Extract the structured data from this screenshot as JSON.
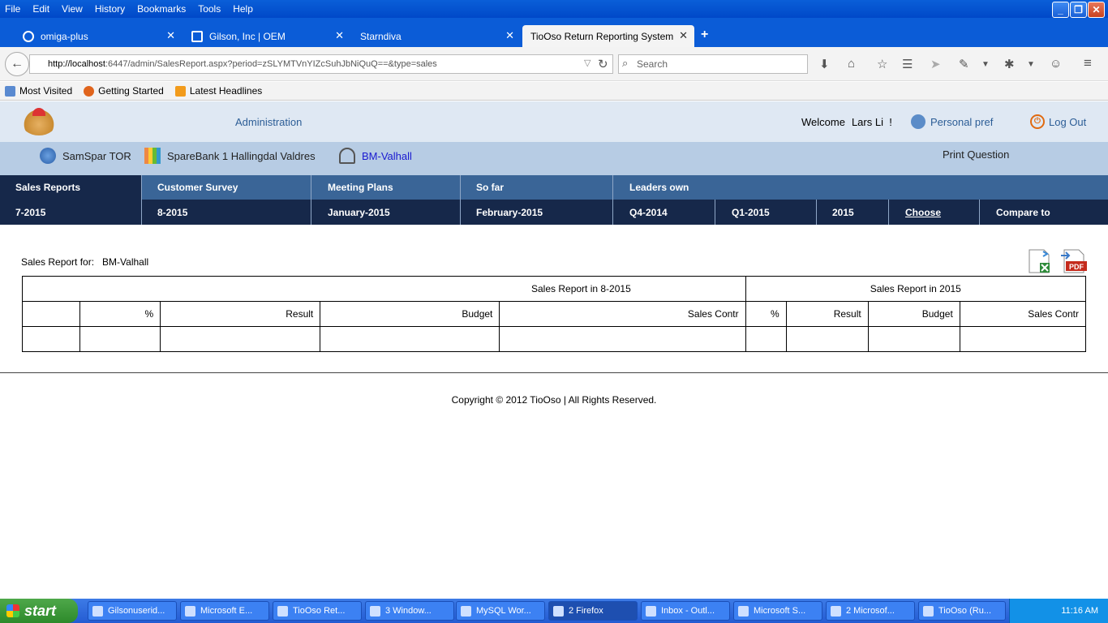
{
  "menu": [
    "File",
    "Edit",
    "View",
    "History",
    "Bookmarks",
    "Tools",
    "Help"
  ],
  "tabs": [
    {
      "label": "omiga-plus"
    },
    {
      "label": "Gilson, Inc | OEM"
    },
    {
      "label": "Starndiva"
    },
    {
      "label": "TioOso Return Reporting System"
    }
  ],
  "url": {
    "host": "http://localhost",
    "rest": ":6447/admin/SalesReport.aspx?period=zSLYMTVnYIZcSuhJbNiQuQ==&type=sales"
  },
  "search": {
    "placeholder": "Search"
  },
  "bookmarks": [
    "Most Visited",
    "Getting Started",
    "Latest Headlines"
  ],
  "header": {
    "admin": "Administration",
    "welcome": "Welcome",
    "user": "Lars Li",
    "excl": "!",
    "personal": "Personal pref",
    "logout": "Log Out"
  },
  "banks": [
    "SamSpar TOR",
    "SpareBank 1 Hallingdal Valdres",
    "BM-Valhall"
  ],
  "print_question": "Print Question",
  "nav_top": [
    "Sales Reports",
    "Customer Survey",
    "Meeting Plans",
    "So far",
    "Leaders own"
  ],
  "nav_bottom": [
    "7-2015",
    "8-2015",
    "January-2015",
    "February-2015",
    "Q4-2014",
    "Q1-2015",
    "2015",
    "Choose",
    "Compare to"
  ],
  "report": {
    "for_label": "Sales Report for:",
    "for_value": "BM-Valhall",
    "group1": "Sales Report in 8-2015",
    "group2": "Sales Report in 2015",
    "cols": [
      "%",
      "Result",
      "Budget",
      "Sales Contr"
    ]
  },
  "copyright": "Copyright © 2012 TioOso | All Rights Reserved.",
  "taskbar": {
    "start": "start",
    "items": [
      "Gilsonuserid...",
      "Microsoft E...",
      "TioOso Ret...",
      "3 Window...",
      "MySQL Wor...",
      "2 Firefox",
      "Inbox - Outl...",
      "Microsoft S...",
      "2 Microsof...",
      "TioOso (Ru..."
    ],
    "time": "11:16 AM"
  },
  "colors": {
    "nav_top": "#3a6597",
    "nav_bottom": "#16284a",
    "header_light": "#dfe8f3",
    "header_mid": "#b7cce4",
    "link": "#2c5d96",
    "active_bank": "#1a1ad0"
  }
}
